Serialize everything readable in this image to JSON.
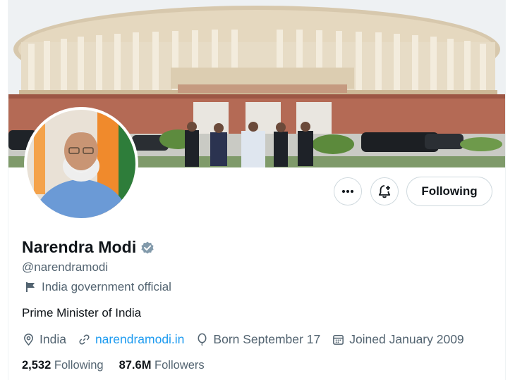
{
  "profile": {
    "name": "Narendra Modi",
    "handle": "@narendramodi",
    "label": "India government official",
    "bio": "Prime Minister of India",
    "location": "India",
    "website": "narendramodi.in",
    "birthday": "Born September 17",
    "joined": "Joined January 2009",
    "following_count": "2,532",
    "following_label": "Following",
    "followers_count": "87.6M",
    "followers_label": "Followers"
  },
  "actions": {
    "follow_label": "Following",
    "more_icon": "more-horizontal-icon",
    "notify_icon": "bell-plus-icon"
  },
  "colors": {
    "accent": "#1d9bf0",
    "verified_badge": "#829aab",
    "secondary_text": "#536471"
  }
}
